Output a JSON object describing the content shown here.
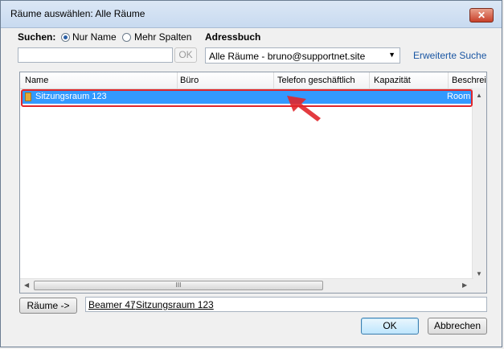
{
  "window": {
    "title": "Räume auswählen: Alle Räume",
    "close_label": "✕"
  },
  "search": {
    "label": "Suchen:",
    "radio_name_only": "Nur Name",
    "radio_more_columns": "Mehr Spalten",
    "input_value": "",
    "ok_button": "OK"
  },
  "addressbook": {
    "label": "Adressbuch",
    "selected": "Alle Räume - bruno@supportnet.site",
    "advanced_search": "Erweiterte Suche"
  },
  "list": {
    "columns": [
      "Name",
      "Büro",
      "Telefon geschäftlich",
      "Kapazität",
      "Beschreib"
    ],
    "rows": [
      {
        "name": "Sitzungsraum 123",
        "type": "Room"
      }
    ],
    "thumb_grip": "III"
  },
  "bottom": {
    "rooms_button": "Räume ->",
    "selected_rooms": [
      "Beamer 47",
      "Sitzungsraum 123"
    ],
    "separator": ";",
    "ok_button": "OK",
    "cancel_button": "Abbrechen"
  },
  "colors": {
    "selection": "#3399ff",
    "highlight": "#e0262b",
    "link": "#1a56a3"
  }
}
